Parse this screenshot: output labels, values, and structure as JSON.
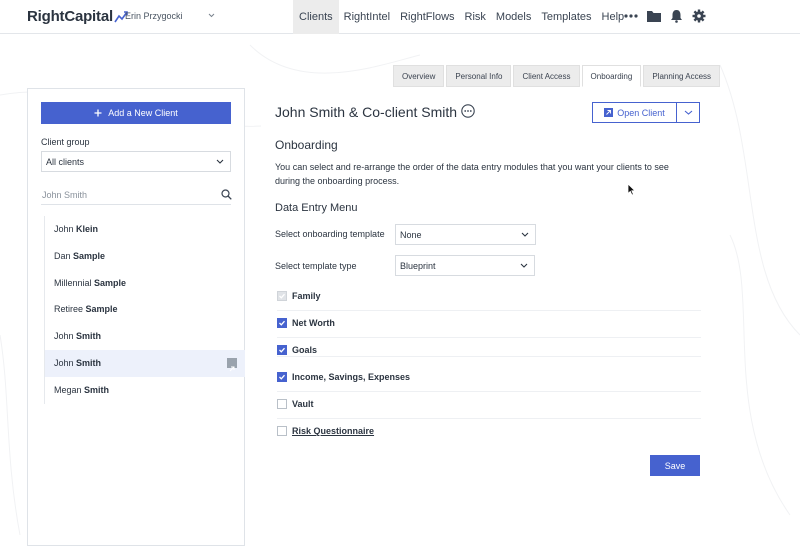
{
  "topbar": {
    "logo": "RightCapital",
    "user_name": "Erin Przygocki",
    "nav": [
      "Clients",
      "RightIntel",
      "RightFlows",
      "Risk",
      "Models",
      "Templates",
      "Help"
    ],
    "active_nav": "Clients",
    "icons": [
      "more-icon",
      "folder-icon",
      "bell-icon",
      "gear-icon"
    ]
  },
  "tabs": [
    "Overview",
    "Personal Info",
    "Client Access",
    "Onboarding",
    "Planning Access"
  ],
  "active_tab": "Onboarding",
  "sidebar": {
    "add_button": "Add a New Client",
    "client_group_label": "Client group",
    "client_group_value": "All clients",
    "search_value": "John Smith",
    "clients": [
      {
        "first": "John",
        "last": "Klein"
      },
      {
        "first": "Dan",
        "last": "Sample"
      },
      {
        "first": "Millennial",
        "last": "Sample"
      },
      {
        "first": "Retiree",
        "last": "Sample"
      },
      {
        "first": "John",
        "last": "Smith"
      },
      {
        "first": "John",
        "last": "Smith",
        "selected": true
      },
      {
        "first": "Megan",
        "last": "Smith"
      }
    ]
  },
  "main": {
    "client_title": "John Smith & Co-client Smith",
    "open_client": "Open Client",
    "section_title": "Onboarding",
    "description": "You can select and re-arrange the order of the data entry modules that you want your clients to see during the onboarding process.",
    "menu_title": "Data Entry Menu",
    "template_label": "Select onboarding template",
    "template_value": "None",
    "type_label": "Select template type",
    "type_value": "Blueprint",
    "modules": [
      {
        "label": "Family",
        "state": "disabled"
      },
      {
        "label": "Net Worth",
        "state": "checked"
      },
      {
        "label": "Goals",
        "state": "checked"
      },
      {
        "label": "Income, Savings, Expenses",
        "state": "checked"
      },
      {
        "label": "Vault",
        "state": "unchecked"
      },
      {
        "label": "Risk Questionnaire",
        "state": "unchecked"
      }
    ],
    "save": "Save"
  },
  "colors": {
    "accent": "#4662cf",
    "text": "#2b3440",
    "border": "#dfe3e8"
  }
}
